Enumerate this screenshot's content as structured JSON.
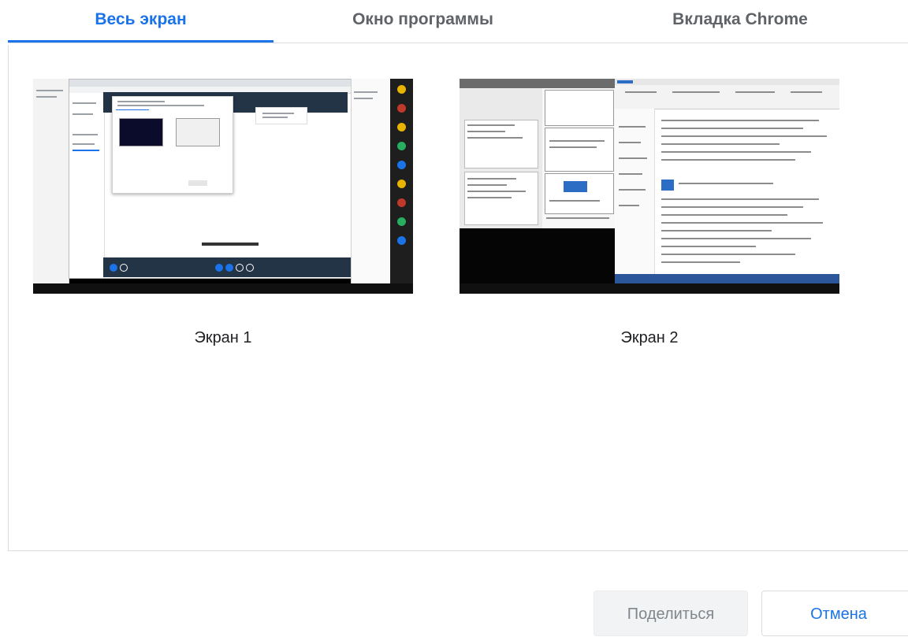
{
  "tabs": [
    {
      "label": "Весь экран",
      "active": true
    },
    {
      "label": "Окно программы",
      "active": false
    },
    {
      "label": "Вкладка Chrome",
      "active": false
    }
  ],
  "screens": [
    {
      "label": "Экран 1"
    },
    {
      "label": "Экран 2"
    }
  ],
  "buttons": {
    "share": "Поделиться",
    "cancel": "Отмена"
  },
  "colors": {
    "accent": "#1a73e8",
    "tab_inactive": "#5f6368",
    "border": "#dadce0",
    "disabled_bg": "#f1f3f4",
    "disabled_text": "#80868b"
  }
}
